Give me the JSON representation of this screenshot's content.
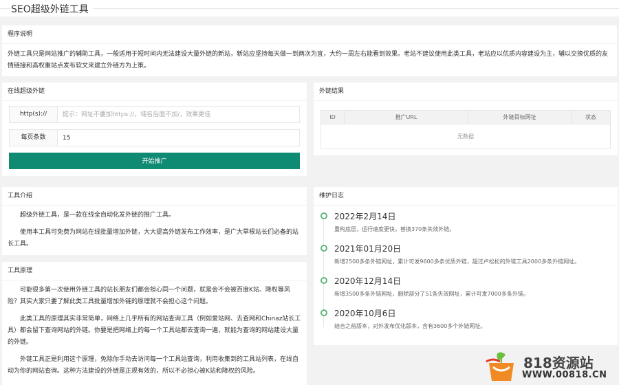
{
  "page_title": "SEO超级外链工具",
  "intro": {
    "title": "程序说明",
    "text": "外链工具只是网站推广的辅助工具，一般适用于短时间内无法建设大量外链的新站，新站应坚持每天做一到两次为宜，大约一周左右能看到效果。老站不建议使用此类工具，老站应以优质内容建设为主，辅以交换优质的友情链接和高权重站点发布软文来建立外链方为上策。"
  },
  "online": {
    "title": "在线超级外链",
    "url_label": "http(s)://",
    "url_placeholder": "提示：网址不要加https://，域名后面不加/，效果更佳",
    "count_label": "每页条数",
    "count_value": "15",
    "submit_label": "开始推广"
  },
  "result": {
    "title": "外链结果",
    "columns": [
      "ID",
      "推广URL",
      "外链目标网址",
      "状态"
    ],
    "empty_text": "无数据"
  },
  "about": {
    "title": "工具介绍",
    "p1": "超级外链工具，是一款在线全自动化发外链的推广工具。",
    "p2": "使用本工具可免费为网站在线批量增加外链，大大提高外链发布工作效率，是广大草根站长们必备的站长工具。"
  },
  "principle": {
    "title": "工具原理",
    "p1": "可能很多第一次使用外链工具的站长朋友们都会担心同一个问题，就是会不会被百度K站、降权等风险？其实大家只要了解此类工具批量增加外链的原理就不会担心这个问题。",
    "p2": "此类工具的原理其实非常简单，网络上几乎所有的网站查询工具（例如爱站网、去查网和Chinaz站长工具）都会留下查询网站的外链。你要是把网络上的每一个工具站都去查询一遍，就能为查询的网站建设大量的外链。",
    "p3": "外链工具正是利用这个原理，免除你手动去访问每一个工具站查询，利用收集到的工具站列表，在线自动为你的网站查询。这种方法建设的外链是正规有效的，所以不必担心被K站和降权的风险。"
  },
  "changelog": {
    "title": "维护日志",
    "items": [
      {
        "date": "2022年2月14日",
        "desc": "重构底层，运行速度更快，替换370条失效外链。"
      },
      {
        "date": "2021年01月20日",
        "desc": "新增2500多条外链网址，累计可发9600多条优质外链，超过卢松松的外链工具2000多条外链网址。"
      },
      {
        "date": "2020年12月14日",
        "desc": "新增3500多条外链网址，删除部分了51条失效网址，累计可发7000多条外链。"
      },
      {
        "date": "2020年10月6日",
        "desc": "结合之前版本，对外发布优化版本，含有3600多个外链网址。"
      }
    ]
  },
  "watermark": {
    "name": "818资源站",
    "url": "WWW.00818.CN"
  }
}
